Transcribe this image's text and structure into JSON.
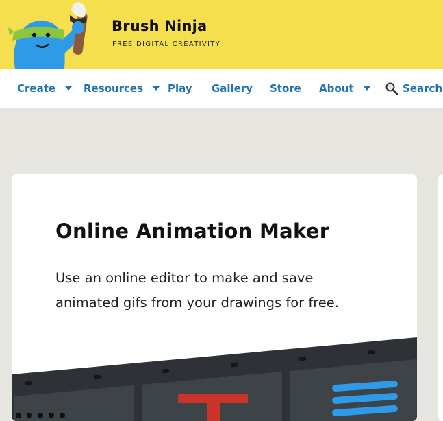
{
  "header": {
    "brand_name": "Brush Ninja",
    "tagline": "FREE DIGITAL CREATIVITY",
    "bg_color": "#f6df4f",
    "logo_icon": "ninja-mascot-icon"
  },
  "nav": {
    "items": [
      {
        "label": "Create",
        "has_dropdown": true
      },
      {
        "label": "Resources",
        "has_dropdown": true
      },
      {
        "label": "Play",
        "has_dropdown": false
      },
      {
        "label": "Gallery",
        "has_dropdown": false
      },
      {
        "label": "Store",
        "has_dropdown": false
      },
      {
        "label": "About",
        "has_dropdown": true
      }
    ],
    "search_label": "Search",
    "search_icon": "magnifier-icon",
    "link_color": "#1f73b5"
  },
  "hero": {
    "title": "Online Animation Maker",
    "description": "Use an online editor to make and save animated gifs from your drawings for free.",
    "illustration_icon": "film-strip-icon"
  }
}
